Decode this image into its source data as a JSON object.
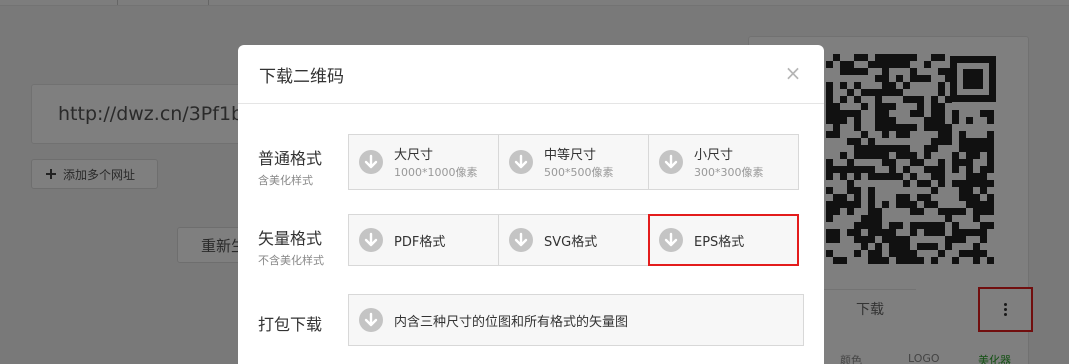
{
  "background": {
    "url_value": "http://dwz.cn/3Pf1b",
    "add_url_label": "添加多个网址",
    "regen_label": "重新生",
    "qr_download_label": "下载",
    "qr_tabs": [
      "颜色",
      "LOGO",
      "美化器"
    ]
  },
  "modal": {
    "title": "下载二维码",
    "close_glyph": "×",
    "rows": [
      {
        "label": "普通格式",
        "sublabel": "含美化样式",
        "options": [
          {
            "title": "大尺寸",
            "subtitle": "1000*1000像素"
          },
          {
            "title": "中等尺寸",
            "subtitle": "500*500像素"
          },
          {
            "title": "小尺寸",
            "subtitle": "300*300像素"
          }
        ]
      },
      {
        "label": "矢量格式",
        "sublabel": "不含美化样式",
        "options": [
          {
            "title": "PDF格式"
          },
          {
            "title": "SVG格式"
          },
          {
            "title": "EPS格式"
          }
        ]
      },
      {
        "label": "打包下载",
        "options": [
          {
            "title": "内含三种尺寸的位图和所有格式的矢量图"
          }
        ]
      }
    ]
  },
  "colors": {
    "highlight": "#e31c1c",
    "active_tab": "#2aa32a",
    "icon_gray": "#c4c4c4"
  },
  "icons": {
    "download": "download-circle-icon",
    "close": "close-icon",
    "more": "vertical-dots-icon",
    "add": "plus-icon"
  }
}
